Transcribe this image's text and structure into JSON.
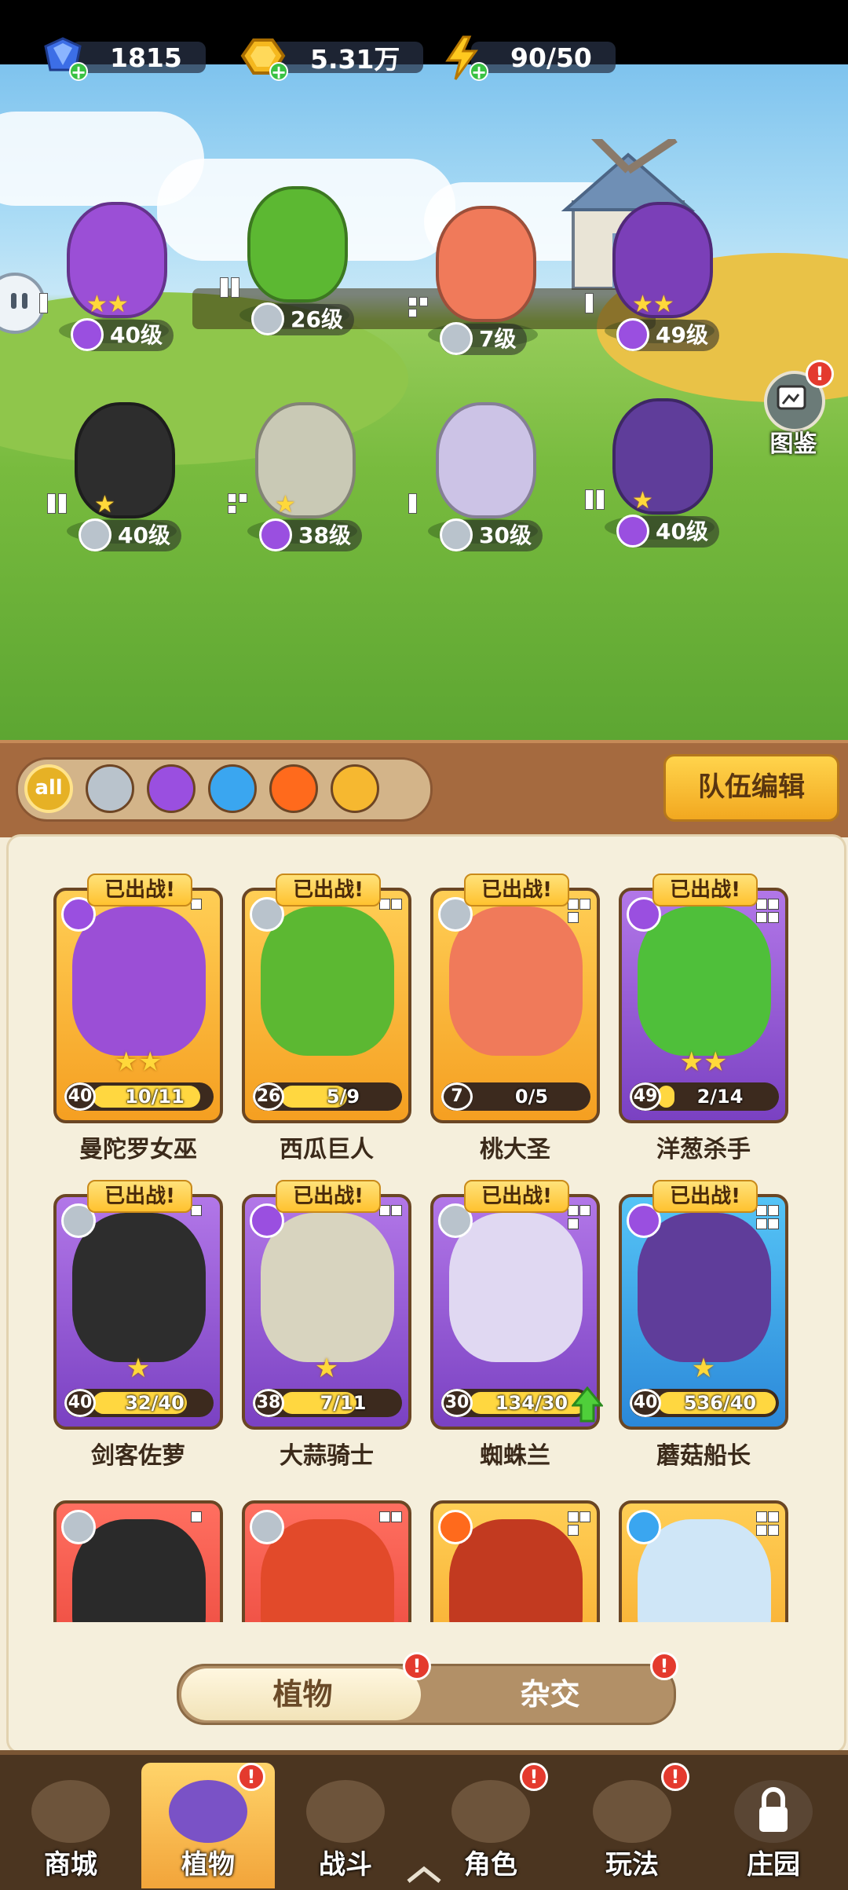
{
  "resources": {
    "gems": "1815",
    "coins": "5.31万",
    "energy": "90/50"
  },
  "tujian_label": "图鉴",
  "team_units": [
    {
      "name": "曼陀罗女巫",
      "level": "40级",
      "color": "#9b4fd6",
      "element": "poison",
      "stars": "★★"
    },
    {
      "name": "西瓜巨人",
      "level": "26级",
      "color": "#5cb832",
      "element": "sword",
      "stars": ""
    },
    {
      "name": "桃大圣",
      "level": "7级",
      "color": "#f07a5a",
      "element": "sword",
      "stars": ""
    },
    {
      "name": "洋葱杀手",
      "level": "49级",
      "color": "#7b3fb8",
      "element": "poison",
      "stars": "★★"
    },
    {
      "name": "剑客佐萝",
      "level": "40级",
      "color": "#2d2d2d",
      "element": "sword",
      "stars": "★"
    },
    {
      "name": "大蒜骑士",
      "level": "38级",
      "color": "#c9c9b5",
      "element": "poison",
      "stars": "★"
    },
    {
      "name": "蜘蛛兰",
      "level": "30级",
      "color": "#ccc3e6",
      "element": "sword",
      "stars": ""
    },
    {
      "name": "蘑菇船长",
      "level": "40级",
      "color": "#5f3d9a",
      "element": "poison",
      "stars": "★"
    }
  ],
  "filters": [
    "all",
    "sword",
    "poison",
    "water",
    "fire",
    "lightning"
  ],
  "team_edit_label": "队伍编辑",
  "deployed_label": "已出战",
  "cards": [
    {
      "name": "曼陀罗女巫",
      "level": "40",
      "progress": "10/11",
      "ratio": 0.91,
      "rarity": "gold",
      "element": "poison",
      "stars": "★★",
      "deployed": true,
      "portrait": "#9b4fd6"
    },
    {
      "name": "西瓜巨人",
      "level": "26",
      "progress": "5/9",
      "ratio": 0.56,
      "rarity": "gold",
      "element": "sword",
      "stars": "",
      "deployed": true,
      "portrait": "#5cb832"
    },
    {
      "name": "桃大圣",
      "level": "7",
      "progress": "0/5",
      "ratio": 0.0,
      "rarity": "gold",
      "element": "sword",
      "stars": "",
      "deployed": true,
      "portrait": "#f07a5a"
    },
    {
      "name": "洋葱杀手",
      "level": "49",
      "progress": "2/14",
      "ratio": 0.14,
      "rarity": "purple",
      "element": "poison",
      "stars": "★★",
      "deployed": true,
      "portrait": "#4fbf3a"
    },
    {
      "name": "剑客佐萝",
      "level": "40",
      "progress": "32/40",
      "ratio": 0.8,
      "rarity": "purple",
      "element": "sword",
      "stars": "★",
      "deployed": true,
      "portrait": "#2d2d2d"
    },
    {
      "name": "大蒜骑士",
      "level": "38",
      "progress": "7/11",
      "ratio": 0.64,
      "rarity": "purple",
      "element": "poison",
      "stars": "★",
      "deployed": true,
      "portrait": "#d8d4bf"
    },
    {
      "name": "蜘蛛兰",
      "level": "30",
      "progress": "134/30",
      "ratio": 1.0,
      "rarity": "purple",
      "element": "sword",
      "stars": "",
      "deployed": true,
      "upgradable": true,
      "portrait": "#e0d8f2"
    },
    {
      "name": "蘑菇船长",
      "level": "40",
      "progress": "536/40",
      "ratio": 1.0,
      "rarity": "blue",
      "element": "poison",
      "stars": "★",
      "deployed": true,
      "portrait": "#5f3d9a"
    },
    {
      "name": "",
      "level": "",
      "progress": "",
      "ratio": 0,
      "rarity": "red",
      "element": "sword",
      "stars": "",
      "deployed": false,
      "portrait": "#2a2a2a"
    },
    {
      "name": "",
      "level": "",
      "progress": "",
      "ratio": 0,
      "rarity": "red",
      "element": "sword",
      "stars": "",
      "deployed": false,
      "portrait": "#e24a2a"
    },
    {
      "name": "",
      "level": "",
      "progress": "",
      "ratio": 0,
      "rarity": "gold",
      "element": "fire",
      "stars": "",
      "deployed": false,
      "portrait": "#c23a20"
    },
    {
      "name": "",
      "level": "",
      "progress": "",
      "ratio": 0,
      "rarity": "gold",
      "element": "water",
      "stars": "",
      "deployed": false,
      "portrait": "#cfe6f7"
    }
  ],
  "toggle": {
    "plants": "植物",
    "hybrid": "杂交"
  },
  "nav": [
    {
      "label": "商城",
      "icon": "shop-icon",
      "active": false,
      "alert": false
    },
    {
      "label": "植物",
      "icon": "plants-icon",
      "active": true,
      "alert": true
    },
    {
      "label": "战斗",
      "icon": "battle-icon",
      "active": false,
      "alert": false
    },
    {
      "label": "角色",
      "icon": "character-icon",
      "active": false,
      "alert": true
    },
    {
      "label": "玩法",
      "icon": "gameplay-icon",
      "active": false,
      "alert": true
    },
    {
      "label": "庄园",
      "icon": "lock-icon",
      "active": false,
      "alert": false
    }
  ],
  "colors": {
    "sword": "#b9c3cc",
    "poison": "#9a4fe0",
    "water": "#3aa6f0",
    "fire": "#ff6a1c",
    "lightning": "#f6b830",
    "all": "#e6b125"
  }
}
